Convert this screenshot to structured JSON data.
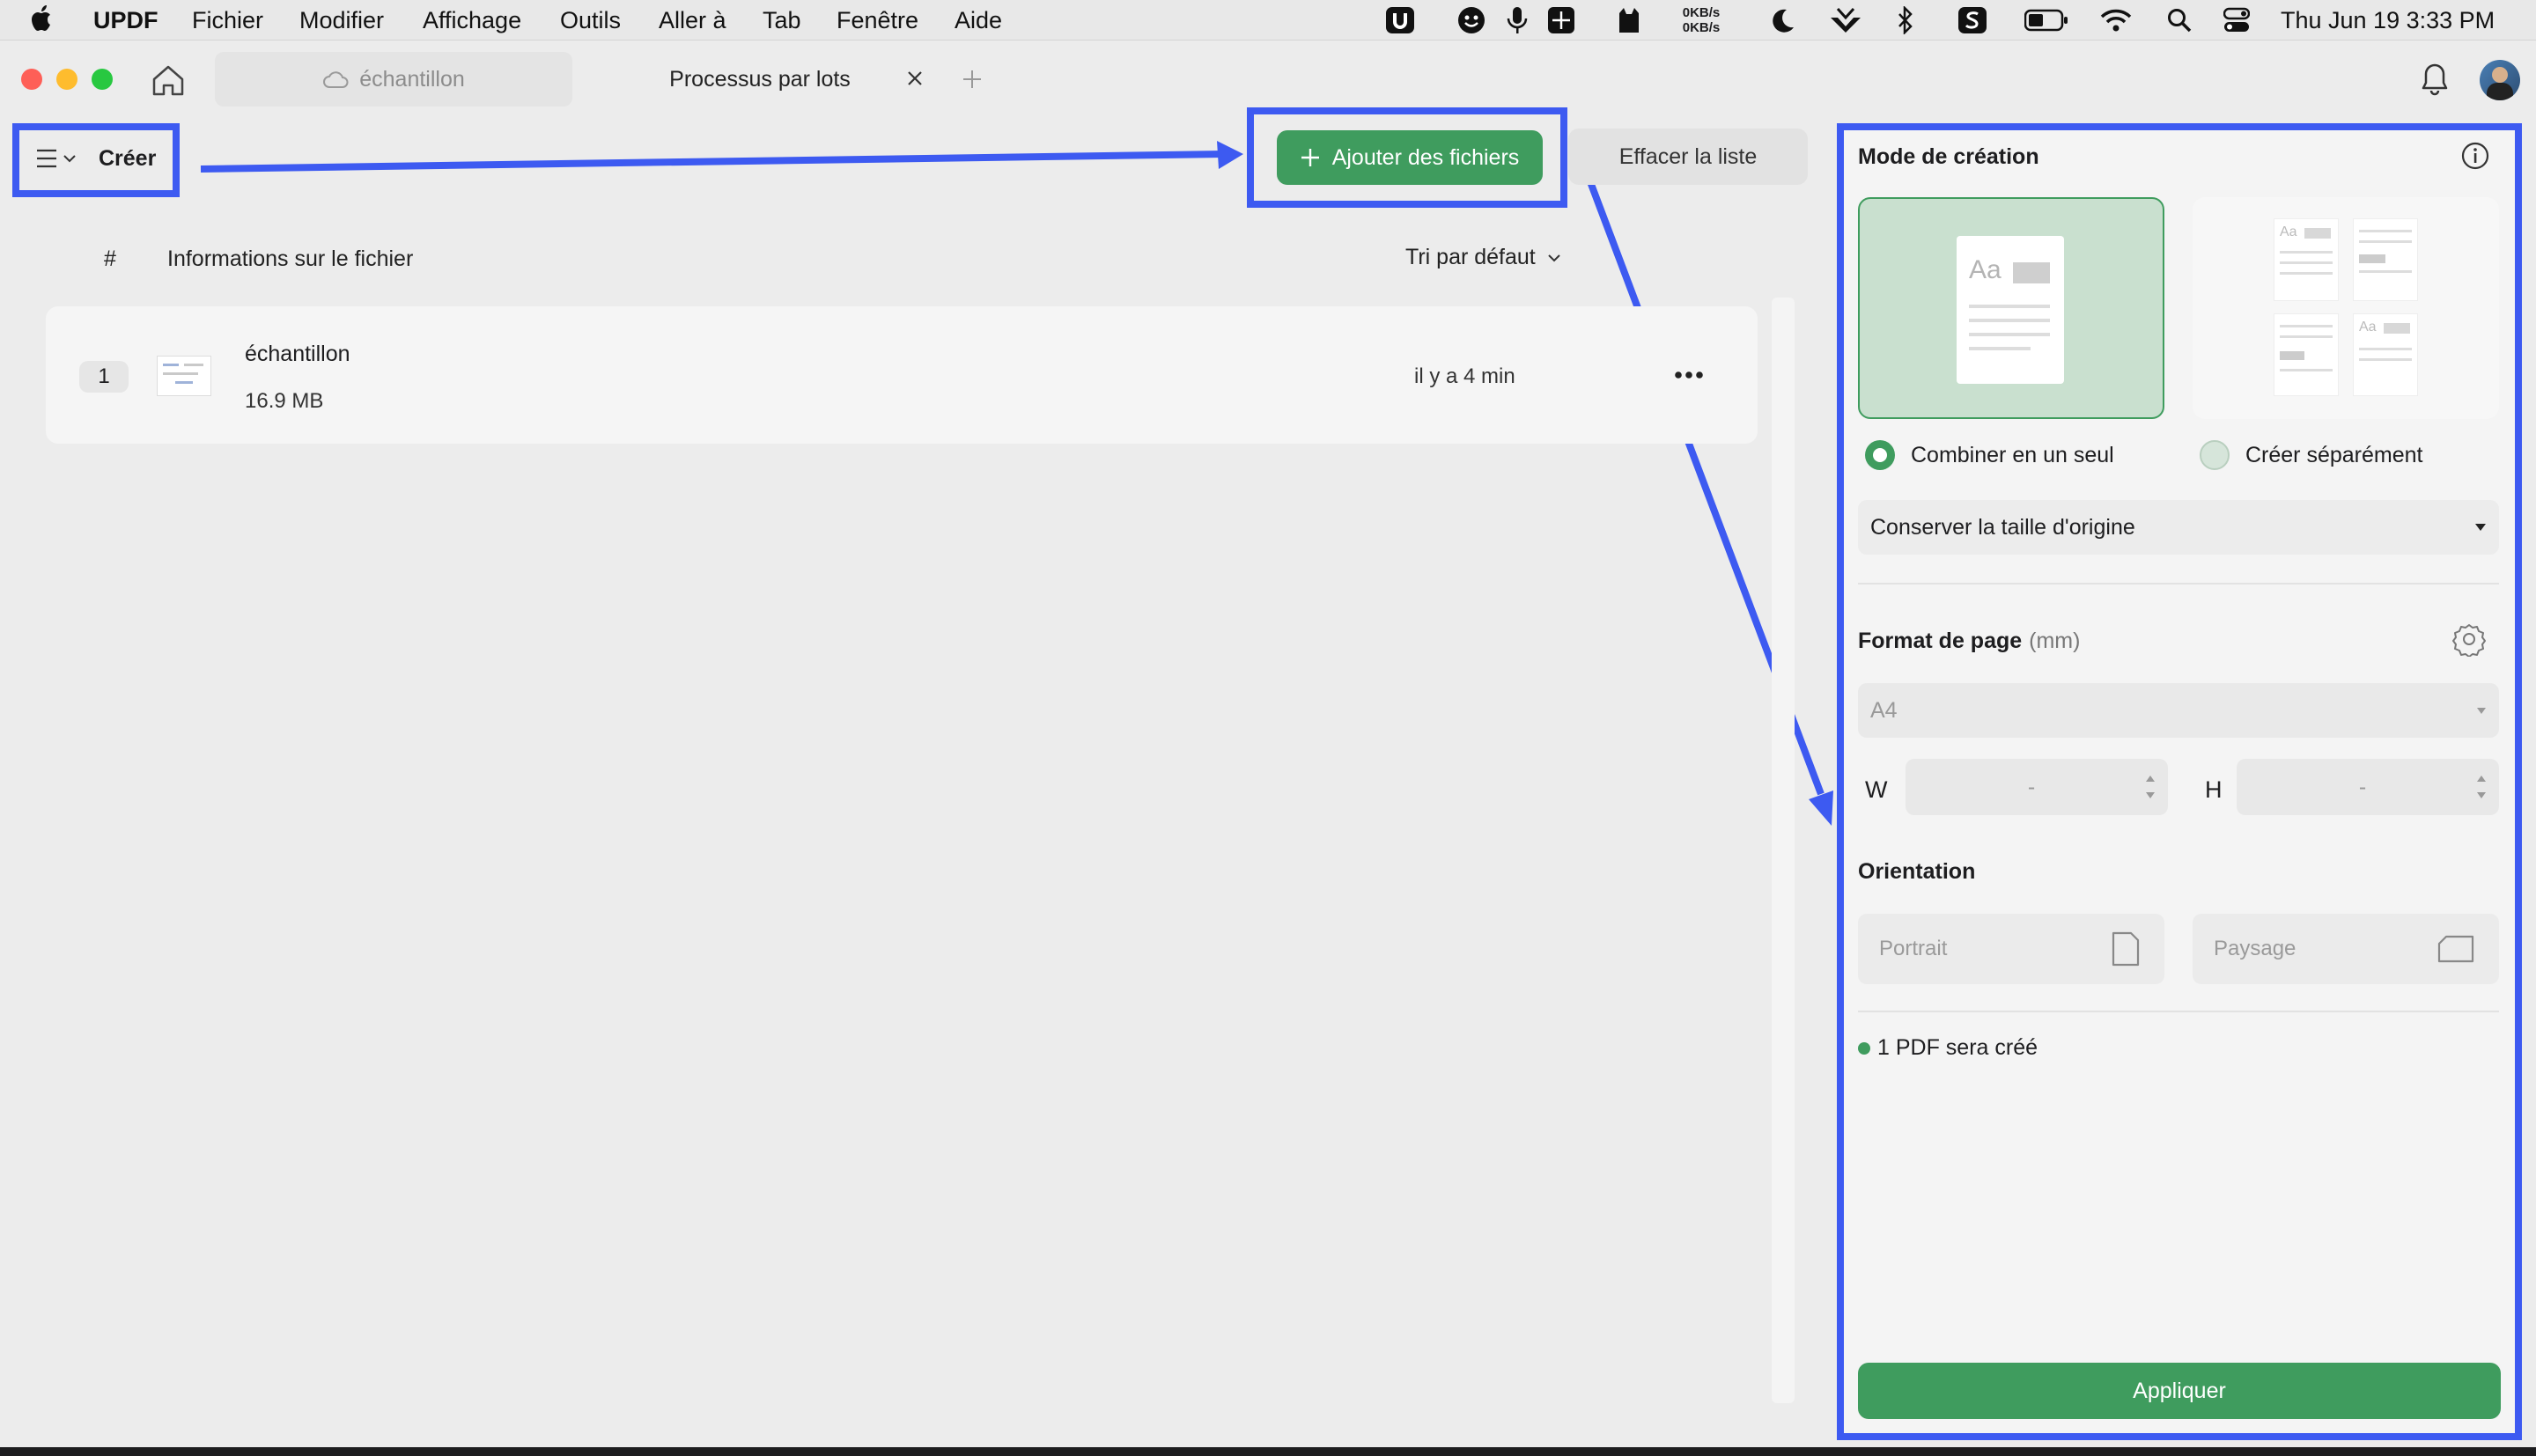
{
  "menubar": {
    "app_name": "UPDF",
    "items": [
      "Fichier",
      "Modifier",
      "Affichage",
      "Outils",
      "Aller à",
      "Tab",
      "Fenêtre",
      "Aide"
    ],
    "net_speed_up": "0KB/s",
    "net_speed_down": "0KB/s",
    "clock": "Thu Jun 19  3:33 PM"
  },
  "tabs": {
    "tab1_label": "échantillon",
    "tab2_label": "Processus par lots"
  },
  "toolbar": {
    "mode_label": "Créer",
    "add_files_label": "Ajouter des fichiers",
    "clear_list_label": "Effacer la liste"
  },
  "file_list": {
    "header_number": "#",
    "header_info": "Informations sur le fichier",
    "sort_label": "Tri par défaut",
    "rows": [
      {
        "index": "1",
        "name": "échantillon",
        "size": "16.9 MB",
        "modified": "il y a 4 min"
      }
    ]
  },
  "panel": {
    "mode_title": "Mode de création",
    "option_combine": "Combiner en un seul",
    "option_separate": "Créer séparément",
    "selected_mode": "combine",
    "size_select_value": "Conserver la taille d'origine",
    "page_format_label": "Format de page",
    "page_format_unit": "(mm)",
    "format_select_value": "A4",
    "width_label": "W",
    "width_value": "-",
    "height_label": "H",
    "height_value": "-",
    "orientation_label": "Orientation",
    "portrait_label": "Portrait",
    "landscape_label": "Paysage",
    "status_text": "1 PDF sera créé",
    "apply_label": "Appliquer"
  },
  "colors": {
    "accent_green": "#3f9c5e",
    "annotation_blue": "#3d5af1"
  }
}
